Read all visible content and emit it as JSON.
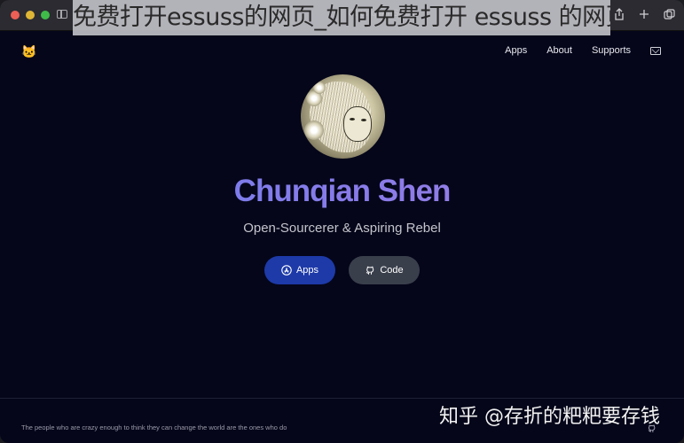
{
  "browser": {
    "address": "Chunqian Shen",
    "overlay_banner": "免费打开essuss的网页_如何免费打开 essuss 的网页？",
    "toolbar_icons": [
      "share-icon",
      "new-tab-icon",
      "tabs-overview-icon"
    ]
  },
  "nav": {
    "logo": "🐱",
    "links": [
      "Apps",
      "About",
      "Supports"
    ],
    "mail_icon": "mail-icon"
  },
  "hero": {
    "name": "Chunqian Shen",
    "tagline": "Open-Sourcerer & Aspiring Rebel",
    "buttons": [
      {
        "label": "Apps",
        "icon": "app-store-icon",
        "color": "#1d3aa8"
      },
      {
        "label": "Code",
        "icon": "github-icon",
        "color": "#3a3f4c"
      }
    ],
    "name_gradient": [
      "#6b7ef0",
      "#a585df"
    ]
  },
  "footer": {
    "quote": "The people who are crazy enough to think they can change the world are the ones who do",
    "github_icon": "github-icon"
  },
  "watermark": "知乎 @存折的粑粑要存钱"
}
